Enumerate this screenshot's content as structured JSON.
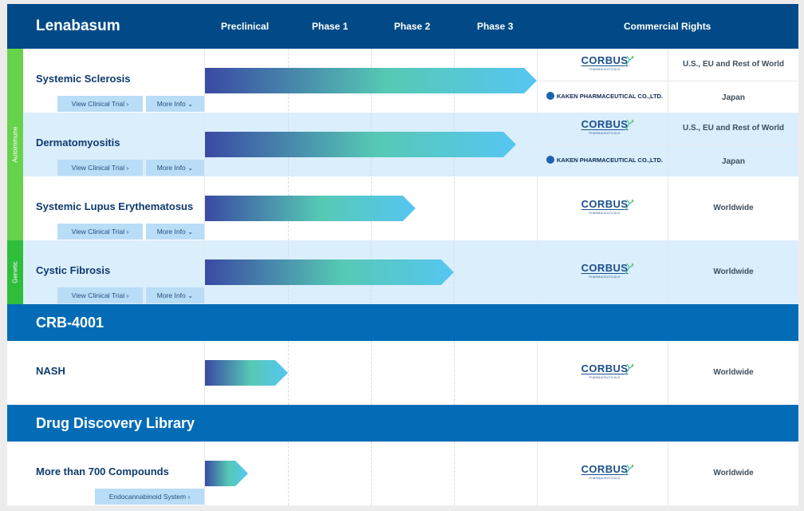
{
  "header": {
    "drug": "Lenabasum",
    "phases": [
      "Preclinical",
      "Phase 1",
      "Phase 2",
      "Phase 3"
    ],
    "rights_title": "Commercial Rights"
  },
  "side_labels": {
    "autoimmune": "Autoimmune",
    "genetic": "Genetic"
  },
  "buttons": {
    "view_trial": "View Clinical Trial ›",
    "more_info": "More Info ⌄",
    "endocannabinoid": "Endocannabinoid System ›"
  },
  "partners": {
    "corbus": "CORBUS",
    "corbus_sub": "PHARMACEUTICALS",
    "kaken": "KAKEN PHARMACEUTICAL CO.,LTD."
  },
  "lenabasum_rows": [
    {
      "indication": "Systemic Sclerosis",
      "progress_stage": "Phase 3 (complete)",
      "rights": [
        "U.S., EU and Rest of World",
        "Japan"
      ]
    },
    {
      "indication": "Dermatomyositis",
      "progress_stage": "Phase 3",
      "rights": [
        "U.S., EU and Rest of World",
        "Japan"
      ]
    },
    {
      "indication": "Systemic Lupus Erythematosus",
      "progress_stage": "Phase 2",
      "rights": [
        "Worldwide"
      ]
    },
    {
      "indication": "Cystic Fibrosis",
      "progress_stage": "Phase 2 (complete)",
      "rights": [
        "Worldwide"
      ]
    }
  ],
  "crb": {
    "title": "CRB-4001",
    "rows": [
      {
        "indication": "NASH",
        "progress_stage": "Preclinical",
        "rights": [
          "Worldwide"
        ]
      }
    ]
  },
  "library": {
    "title": "Drug Discovery Library",
    "rows": [
      {
        "indication": "More than 700 Compounds",
        "progress_stage": "Preclinical",
        "rights": [
          "Worldwide"
        ]
      }
    ]
  },
  "colors": {
    "header_navy": "#014a87",
    "band_blue": "#046cb6",
    "row_blue": "#dbeefc",
    "autoimmune_green": "#67d34c",
    "genetic_green": "#2fbd3c",
    "bar_start": "#3a4aa3",
    "bar_mid": "#56c9b4",
    "bar_end": "#56c6f2"
  }
}
